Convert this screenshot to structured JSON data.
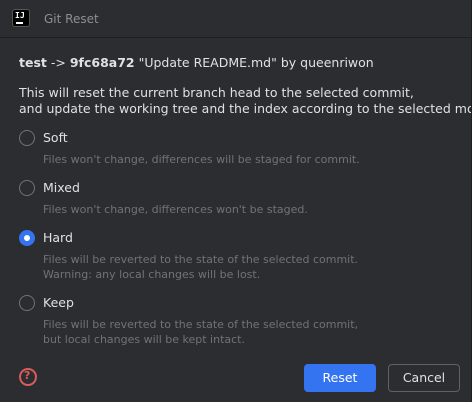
{
  "window": {
    "title": "Git Reset",
    "app_icon_text": "IJ"
  },
  "header": {
    "branch": "test",
    "arrow": "->",
    "commit_hash": "9fc68a72",
    "commit_message": "\"Update README.md\"",
    "by_author": "by queenriwon"
  },
  "description": {
    "line1": "This will reset the current branch head to the selected commit,",
    "line2": "and update the working tree and the index according to the selected mode:"
  },
  "modes": [
    {
      "label": "Soft",
      "help1": "Files won't change, differences will be staged for commit.",
      "help2": "",
      "checked": false
    },
    {
      "label": "Mixed",
      "help1": "Files won't change, differences won't be staged.",
      "help2": "",
      "checked": false
    },
    {
      "label": "Hard",
      "help1": "Files will be reverted to the state of the selected commit.",
      "help2": "Warning: any local changes will be lost.",
      "checked": true
    },
    {
      "label": "Keep",
      "help1": "Files will be reverted to the state of the selected commit,",
      "help2": "but local changes will be kept intact.",
      "checked": false
    }
  ],
  "footer": {
    "help_icon": "?",
    "reset_label": "Reset",
    "cancel_label": "Cancel"
  },
  "colors": {
    "accent": "#3574f0",
    "background": "#2b2d30",
    "help_red": "#db5c5c"
  }
}
